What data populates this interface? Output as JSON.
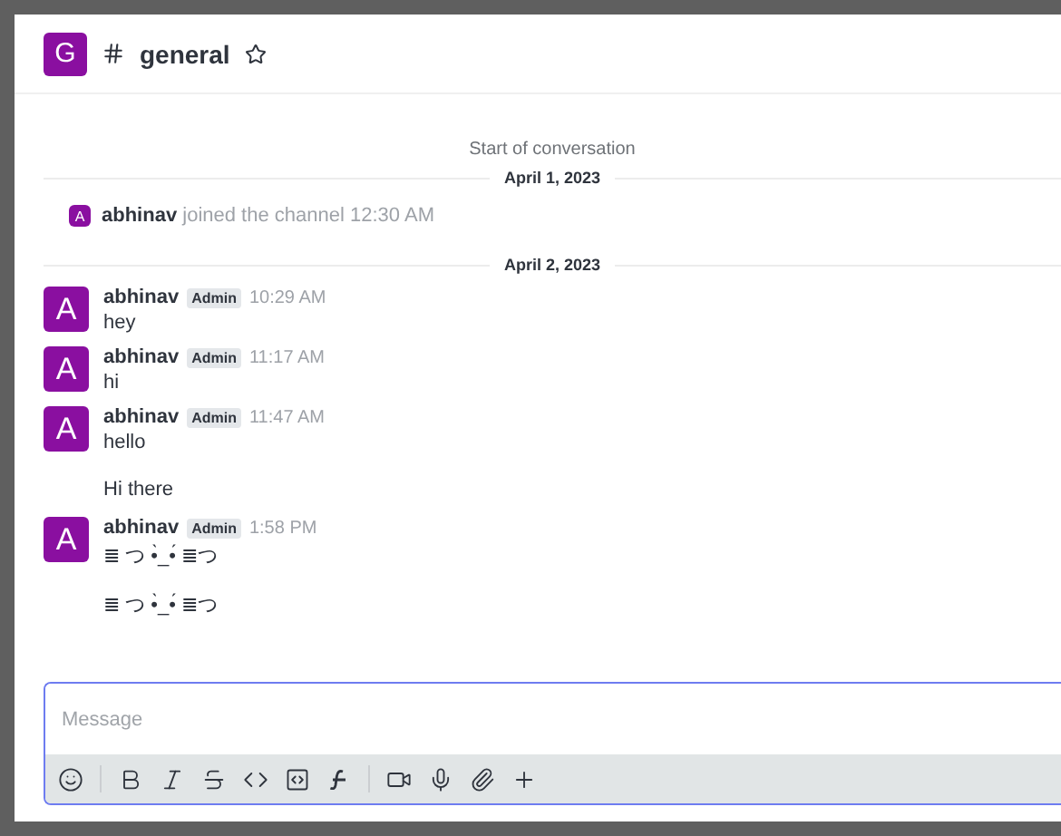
{
  "header": {
    "avatar": "G",
    "channel": "general",
    "starred": false
  },
  "start_label": "Start of conversation",
  "days": [
    {
      "date": "April 1, 2023",
      "items": [
        {
          "kind": "join",
          "avatar": "A",
          "author": "abhinav",
          "text": "joined the channel",
          "time": "12:30 AM"
        }
      ]
    },
    {
      "date": "April 2, 2023",
      "items": [
        {
          "kind": "message",
          "avatar": "A",
          "author": "abhinav",
          "role": "Admin",
          "time": "10:29 AM",
          "text": "hey"
        },
        {
          "kind": "message",
          "avatar": "A",
          "author": "abhinav",
          "role": "Admin",
          "time": "11:17 AM",
          "text": "hi"
        },
        {
          "kind": "message",
          "avatar": "A",
          "author": "abhinav",
          "role": "Admin",
          "time": "11:47 AM",
          "text": "hello"
        },
        {
          "kind": "continuation",
          "text": "Hi there"
        },
        {
          "kind": "message",
          "avatar": "A",
          "author": "abhinav",
          "role": "Admin",
          "time": "1:58 PM",
          "text": "≣ つ •̀_•́ ≣つ"
        },
        {
          "kind": "continuation",
          "text": "≣ つ •̀_•́ ≣つ"
        }
      ]
    }
  ],
  "composer": {
    "placeholder": "Message",
    "focused": true
  }
}
